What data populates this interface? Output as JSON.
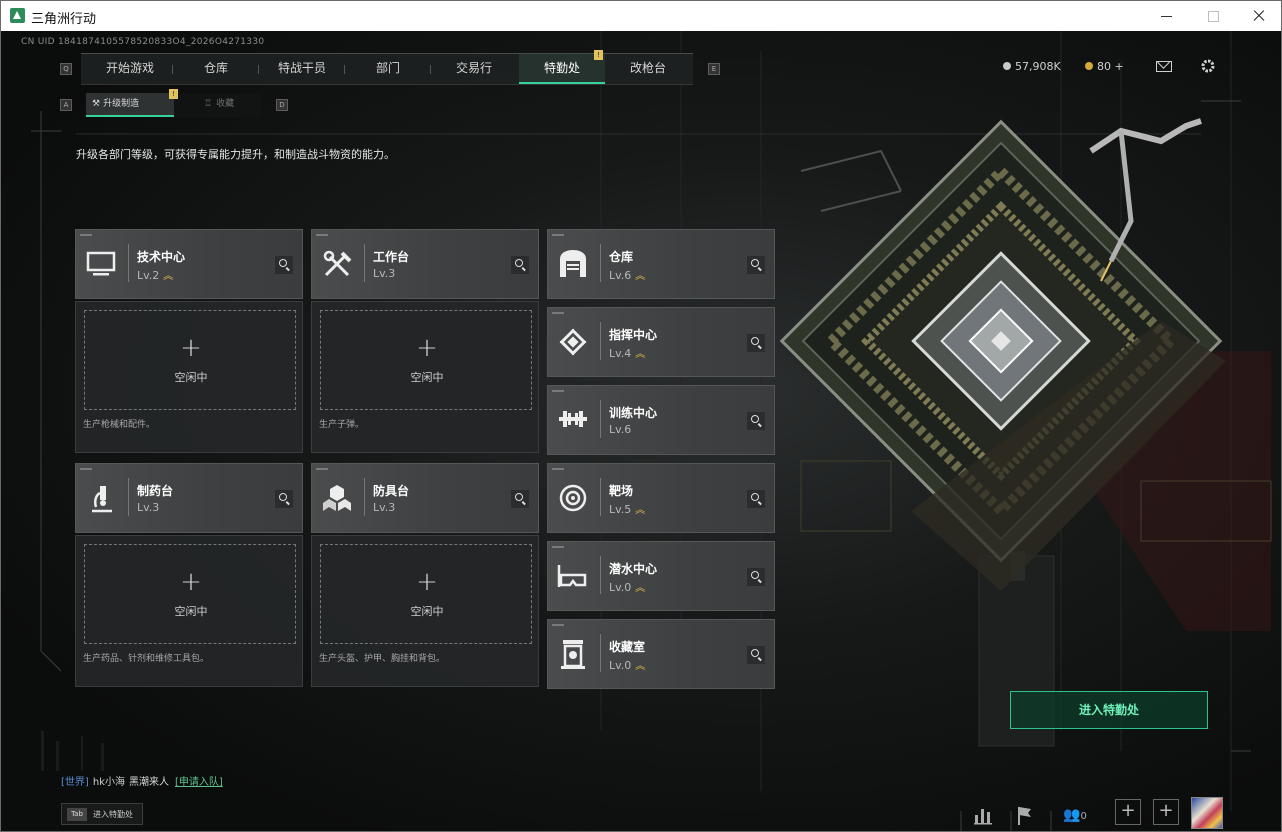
{
  "window": {
    "title": "三角洲行动"
  },
  "uid": "CN UID 1841874105578520833O4_2026O4271330",
  "nav": {
    "key_left": "Q",
    "key_right": "E",
    "tabs": [
      {
        "label": "开始游戏"
      },
      {
        "label": "仓库"
      },
      {
        "label": "特战干员"
      },
      {
        "label": "部门"
      },
      {
        "label": "交易行"
      },
      {
        "label": "特勤处",
        "badge": "!"
      },
      {
        "label": "改枪台"
      }
    ]
  },
  "subnav": {
    "key_left": "A",
    "key_right": "D",
    "upgrade_label": "升级制造",
    "upgrade_badge": "!",
    "collect_label": "收藏"
  },
  "description": "升级各部门等级，可获得专属能力提升，和制造战斗物资的能力。",
  "currency": {
    "coins": "57,908K",
    "tickets": "80",
    "tickets_plus": "+"
  },
  "stations": {
    "tech": {
      "name": "技术中心",
      "level": "Lv.2",
      "upgrade": "≈"
    },
    "workbench": {
      "name": "工作台",
      "level": "Lv.3"
    },
    "pharmacy": {
      "name": "制药台",
      "level": "Lv.3"
    },
    "armor": {
      "name": "防具台",
      "level": "Lv.3"
    },
    "warehouse": {
      "name": "仓库",
      "level": "Lv.6",
      "upgrade": "≈"
    },
    "command": {
      "name": "指挥中心",
      "level": "Lv.4",
      "upgrade": "≈"
    },
    "training": {
      "name": "训练中心",
      "level": "Lv.6"
    },
    "range": {
      "name": "靶场",
      "level": "Lv.5",
      "upgrade": "≈"
    },
    "diving": {
      "name": "潜水中心",
      "level": "Lv.0",
      "upgrade": "≈"
    },
    "collection": {
      "name": "收藏室",
      "level": "Lv.0",
      "upgrade": "≈"
    }
  },
  "slots": {
    "plus": "+",
    "idle": "空闲中",
    "tech_desc": "生产枪械和配件。",
    "workbench_desc": "生产子弹。",
    "pharmacy_desc": "生产药品、针剂和维修工具包。",
    "armor_desc": "生产头盔、护甲、胸挂和背包。"
  },
  "enter_button": "进入特勤处",
  "chat": {
    "channel": "[世界]",
    "user": "hk小海",
    "message": "黑潮来人",
    "link": "[申请入队]"
  },
  "tab_hint": {
    "key": "Tab",
    "text": "进入特勤处"
  },
  "bottom": {
    "friends_count": "0",
    "plus": "+"
  },
  "colors": {
    "accent": "#35d39a",
    "badge": "#e2c25c",
    "upgrade": "#e0b84e",
    "coin": "#c9c9c9",
    "ticket": "#d8a93a"
  }
}
